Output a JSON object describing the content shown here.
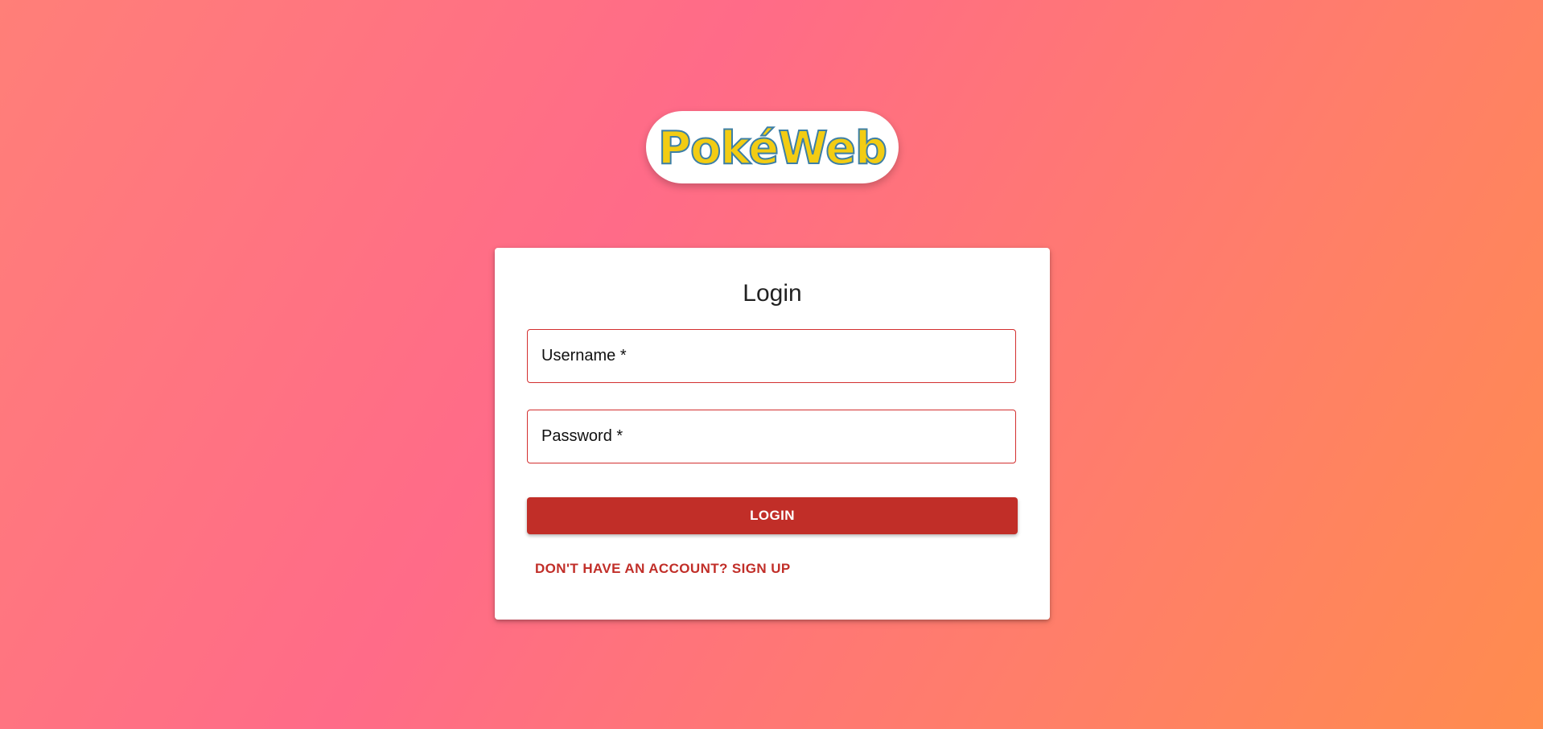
{
  "logo": {
    "text": "PokéWeb"
  },
  "login_form": {
    "title": "Login",
    "username_label": "Username *",
    "password_label": "Password *",
    "submit_label": "LOGIN",
    "signup_link": "DON'T HAVE AN ACCOUNT? SIGN UP"
  },
  "colors": {
    "primary": "#c12e28",
    "field_border": "#d32f2f",
    "logo_fill": "#f2cc13",
    "logo_stroke": "#3d7fa6",
    "background_gradient": [
      "#ff6b88",
      "#ff8c4e"
    ]
  }
}
